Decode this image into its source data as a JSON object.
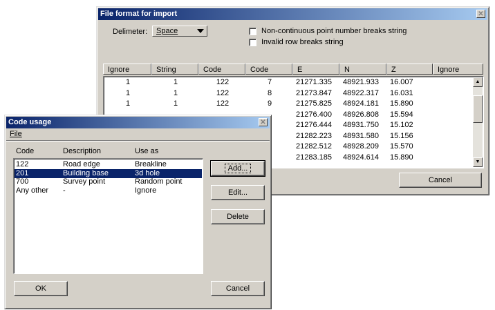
{
  "import_dialog": {
    "title": "File format for import",
    "close_glyph": "✕",
    "delimiter_label": "Delimeter:",
    "delimiter_value": "Space",
    "checkbox_noncontinuous": "Non-continuous point number breaks string",
    "checkbox_invalid_row": "Invalid row breaks string",
    "columns": [
      "Ignore",
      "String",
      "Code",
      "Code",
      "E",
      "N",
      "Z",
      "Ignore"
    ],
    "rows": [
      {
        "string": "1",
        "point": "1",
        "code1": "122",
        "code2": "7",
        "e": "21271.335",
        "n": "48921.933",
        "z": "16.007"
      },
      {
        "string": "1",
        "point": "1",
        "code1": "122",
        "code2": "8",
        "e": "21273.847",
        "n": "48922.317",
        "z": "16.031"
      },
      {
        "string": "1",
        "point": "1",
        "code1": "122",
        "code2": "9",
        "e": "21275.825",
        "n": "48924.181",
        "z": "15.890"
      },
      {
        "string": "",
        "point": "",
        "code1": "",
        "code2": "",
        "e": "21276.400",
        "n": "48926.808",
        "z": "15.594"
      },
      {
        "string": "",
        "point": "",
        "code1": "",
        "code2": "",
        "e": "21276.444",
        "n": "48931.750",
        "z": "15.102"
      },
      {
        "string": "",
        "point": "",
        "code1": "",
        "code2": "",
        "e": "21282.223",
        "n": "48931.580",
        "z": "15.156"
      },
      {
        "string": "",
        "point": "",
        "code1": "",
        "code2": "",
        "e": "21282.512",
        "n": "48928.209",
        "z": "15.570"
      },
      {
        "string": "",
        "point": "",
        "code1": "",
        "code2": "",
        "e": "21283.185",
        "n": "48924.614",
        "z": "15.890"
      }
    ],
    "cancel_label": "Cancel"
  },
  "code_dialog": {
    "title": "Code usage",
    "close_glyph": "✕",
    "menu_file": "File",
    "headers": {
      "code": "Code",
      "description": "Description",
      "use_as": "Use as"
    },
    "rows": [
      {
        "code": "122",
        "description": "Road edge",
        "use_as": "Breakline",
        "selected": false
      },
      {
        "code": "201",
        "description": "Building base",
        "use_as": "3d hole",
        "selected": true
      },
      {
        "code": "700",
        "description": "Survey point",
        "use_as": "Random point",
        "selected": false
      },
      {
        "code": "Any other",
        "description": "-",
        "use_as": "Ignore",
        "selected": false
      }
    ],
    "add_label": "Add...",
    "edit_label": "Edit...",
    "delete_label": "Delete",
    "ok_label": "OK",
    "cancel_label": "Cancel"
  }
}
